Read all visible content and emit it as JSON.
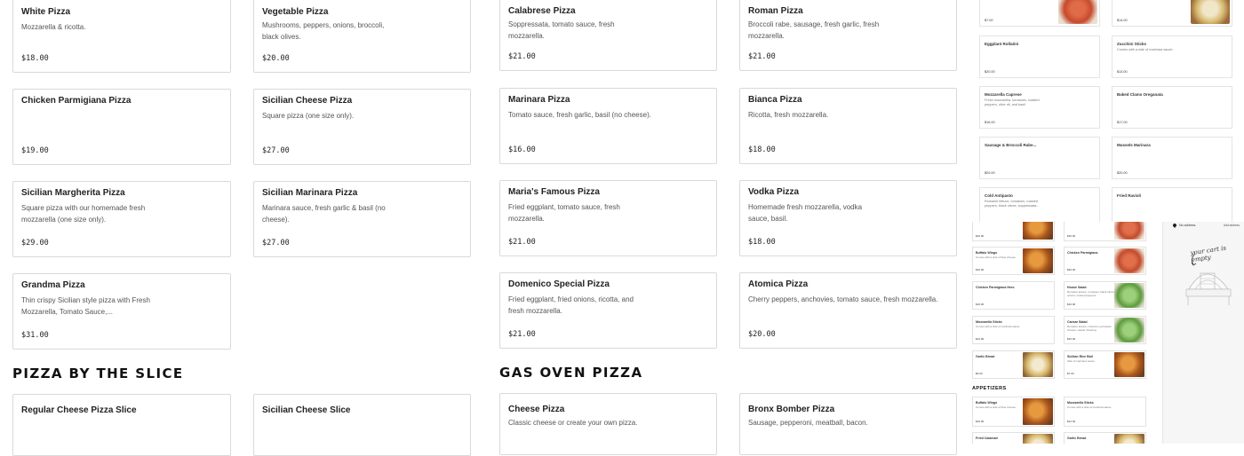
{
  "left_items": [
    {
      "name": "White Pizza",
      "desc": "Mozzarella & ricotta.",
      "price": "$18.00"
    },
    {
      "name": "Vegetable Pizza",
      "desc": "Mushrooms, peppers, onions, broccoli, black olives.",
      "price": "$20.00"
    },
    {
      "name": "Chicken Parmigiana Pizza",
      "desc": "",
      "price": "$19.00"
    },
    {
      "name": "Sicilian Cheese Pizza",
      "desc": "Square pizza (one size only).",
      "price": "$27.00"
    },
    {
      "name": "Sicilian Margherita Pizza",
      "desc": "Square pizza with our homemade fresh mozzarella (one size only).",
      "price": "$29.00"
    },
    {
      "name": "Sicilian Marinara Pizza",
      "desc": "Marinara sauce, fresh garlic & basil (no cheese).",
      "price": "$27.00"
    },
    {
      "name": "Grandma Pizza",
      "desc": "Thin crispy Sicilian style pizza with Fresh Mozzarella, Tomato Sauce,...",
      "price": "$31.00"
    }
  ],
  "right_items": [
    {
      "name": "Calabrese Pizza",
      "desc": "Soppressata, tomato sauce, fresh mozzarella.",
      "price": "$21.00"
    },
    {
      "name": "Roman Pizza",
      "desc": "Broccoli rabe, sausage, fresh garlic, fresh mozzarella.",
      "price": "$21.00"
    },
    {
      "name": "Marinara Pizza",
      "desc": "Tomato sauce, fresh garlic, basil (no cheese).",
      "price": "$16.00"
    },
    {
      "name": "Bianca Pizza",
      "desc": "Ricotta, fresh mozzarella.",
      "price": "$18.00"
    },
    {
      "name": "Maria's Famous Pizza",
      "desc": "Fried eggplant, tomato sauce, fresh mozzarella.",
      "price": "$21.00"
    },
    {
      "name": "Vodka Pizza",
      "desc": "Homemade fresh mozzarella, vodka sauce, basil.",
      "price": "$18.00"
    },
    {
      "name": "Domenico Special Pizza",
      "desc": "Fried eggplant, fried onions, ricotta, and fresh mozzarella.",
      "price": "$21.00"
    },
    {
      "name": "Atomica Pizza",
      "desc": "Cherry peppers, anchovies, tomato sauce, fresh mozzarella.",
      "price": "$20.00"
    }
  ],
  "sections": {
    "slice_title": "PIZZA BY THE SLICE",
    "gas_oven_title": "GAS OVEN PIZZA"
  },
  "slice_items": [
    {
      "name": "Regular Cheese Pizza Slice"
    },
    {
      "name": "Sicilian Cheese Slice"
    }
  ],
  "gas_items": [
    {
      "name": "Cheese Pizza",
      "desc": "Classic cheese or create your own pizza."
    },
    {
      "name": "Bronx Bomber Pizza",
      "desc": "Sausage, pepperoni, meatball, bacon."
    }
  ],
  "thumb_items": [
    {
      "name": "",
      "desc": "",
      "price": "$7.00",
      "img": "r"
    },
    {
      "name": "",
      "desc": "",
      "price": "$14.00",
      "img": "c"
    },
    {
      "name": "Eggplant Rollatini",
      "desc": "",
      "price": "$20.00",
      "img": ""
    },
    {
      "name": "Zucchini Sticks",
      "desc": "Comes with a side of marinara sauce.",
      "price": "$13.00",
      "img": ""
    },
    {
      "name": "Mozzarella Caprese",
      "desc": "Fresh mozzarella, tomatoes, roasted peppers, olive oil, and basil.",
      "price": "$16.00",
      "img": ""
    },
    {
      "name": "Baked Clams Oreganata",
      "desc": "",
      "price": "$17.00",
      "img": ""
    },
    {
      "name": "Sausage & Broccoli Rabe...",
      "desc": "",
      "price": "$20.00",
      "img": ""
    },
    {
      "name": "Mussels Marinara",
      "desc": "",
      "price": "$20.00",
      "img": ""
    },
    {
      "name": "Cold Antipasto",
      "desc": "Romaine lettuce, tomatoes, roasted peppers, black olives, soppressata...",
      "price": "",
      "img": ""
    },
    {
      "name": "Fried Ravioli",
      "desc": "",
      "price": "",
      "img": ""
    }
  ],
  "mini_items": [
    {
      "name": "",
      "price": "$16.00",
      "img": "o"
    },
    {
      "name": "",
      "price": "$16.00",
      "img": "r"
    },
    {
      "name": "Buffalo Wings",
      "desc": "Comes with a side of blue cheese.",
      "price": "$16.00",
      "img": "o"
    },
    {
      "name": "Chicken Parmigiana",
      "price": "$26.00",
      "img": "r"
    },
    {
      "name": "Chicken Parmigiana Hero",
      "price": "$16.00",
      "img": ""
    },
    {
      "name": "House Salad",
      "desc": "Romaine lettuce, tomatoes, black olives, onions, roasted peppers...",
      "price": "$16.00",
      "img": "g"
    },
    {
      "name": "Mozzarella Sticks",
      "desc": "Comes with a side of marinara sauce.",
      "price": "$12.00",
      "img": ""
    },
    {
      "name": "Caesar Salad",
      "desc": "Romaine lettuce, croutons, parmesan cheese, caesar dressing.",
      "price": "$15.00",
      "img": "g"
    },
    {
      "name": "Garlic Bread",
      "price": "$6.00",
      "img": "c"
    },
    {
      "name": "Sicilian Rice Ball",
      "desc": "Side of marinara sauce.",
      "price": "$7.00",
      "img": "o"
    }
  ],
  "appetizers_label": "APPETIZERS",
  "mini_items2": [
    {
      "name": "Buffalo Wings",
      "desc": "Comes with a side of blue cheese.",
      "price": "$16.00",
      "img": "o"
    },
    {
      "name": "Mozzarella Sticks",
      "desc": "Comes with a side of marinara sauce.",
      "price": "$12.00",
      "img": "o"
    },
    {
      "name": "Fried Calamari",
      "price": "",
      "img": "c"
    },
    {
      "name": "Garlic Bread",
      "price": "",
      "img": "c"
    }
  ],
  "cart": {
    "address_label": "No address",
    "edit_label": "Add address",
    "empty_text": "your cart is empty"
  }
}
